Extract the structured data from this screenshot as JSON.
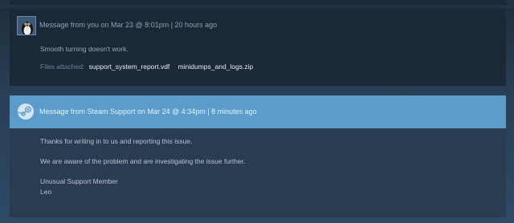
{
  "user_message": {
    "header": "Message from you on Mar 23 @ 8:01pm | 20 hours ago",
    "body": "Smooth turning doesn't work.",
    "files_label": "Files attached:",
    "files": [
      "support_system_report.vdf",
      "minidumps_and_logs.zip"
    ]
  },
  "support_message": {
    "header": "Message from Steam Support on Mar 24 @ 4:34pm | 8 minutes ago",
    "lines": [
      "Thanks for writing in to us and reporting this issue.",
      "We are aware of the problem and are investigating the issue further.",
      "Unusual Support Member",
      "Leo"
    ]
  },
  "colors": {
    "support_header": "#5a9dcb",
    "user_bg": "#1b2838",
    "support_bg": "#2a3c52"
  },
  "icons": {
    "user_avatar": "penguin-avatar",
    "support_avatar": "steam-logo-icon"
  }
}
